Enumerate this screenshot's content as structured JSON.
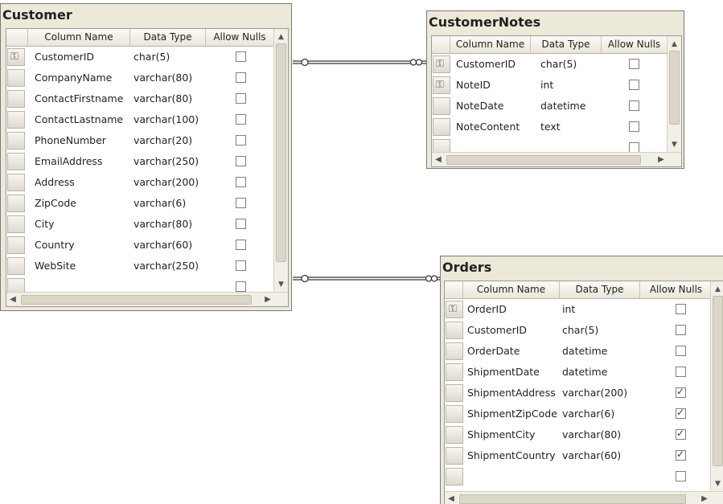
{
  "headers": {
    "column_name": "Column Name",
    "data_type": "Data Type",
    "allow_nulls": "Allow Nulls"
  },
  "tables": {
    "customer": {
      "title": "Customer",
      "rows": [
        {
          "name": "CustomerID",
          "type": "char(5)",
          "pk": true,
          "nulls": false
        },
        {
          "name": "CompanyName",
          "type": "varchar(80)",
          "pk": false,
          "nulls": false
        },
        {
          "name": "ContactFirstname",
          "type": "varchar(80)",
          "pk": false,
          "nulls": false
        },
        {
          "name": "ContactLastname",
          "type": "varchar(100)",
          "pk": false,
          "nulls": false
        },
        {
          "name": "PhoneNumber",
          "type": "varchar(20)",
          "pk": false,
          "nulls": false
        },
        {
          "name": "EmailAddress",
          "type": "varchar(250)",
          "pk": false,
          "nulls": false
        },
        {
          "name": "Address",
          "type": "varchar(200)",
          "pk": false,
          "nulls": false
        },
        {
          "name": "ZipCode",
          "type": "varchar(6)",
          "pk": false,
          "nulls": false
        },
        {
          "name": "City",
          "type": "varchar(80)",
          "pk": false,
          "nulls": false
        },
        {
          "name": "Country",
          "type": "varchar(60)",
          "pk": false,
          "nulls": false
        },
        {
          "name": "WebSite",
          "type": "varchar(250)",
          "pk": false,
          "nulls": false
        }
      ]
    },
    "customer_notes": {
      "title": "CustomerNotes",
      "rows": [
        {
          "name": "CustomerID",
          "type": "char(5)",
          "pk": true,
          "nulls": false
        },
        {
          "name": "NoteID",
          "type": "int",
          "pk": true,
          "nulls": false
        },
        {
          "name": "NoteDate",
          "type": "datetime",
          "pk": false,
          "nulls": false
        },
        {
          "name": "NoteContent",
          "type": "text",
          "pk": false,
          "nulls": false
        }
      ]
    },
    "orders": {
      "title": "Orders",
      "rows": [
        {
          "name": "OrderID",
          "type": "int",
          "pk": true,
          "nulls": false
        },
        {
          "name": "CustomerID",
          "type": "char(5)",
          "pk": false,
          "nulls": false
        },
        {
          "name": "OrderDate",
          "type": "datetime",
          "pk": false,
          "nulls": false
        },
        {
          "name": "ShipmentDate",
          "type": "datetime",
          "pk": false,
          "nulls": false
        },
        {
          "name": "ShipmentAddress",
          "type": "varchar(200)",
          "pk": false,
          "nulls": true
        },
        {
          "name": "ShipmentZipCode",
          "type": "varchar(6)",
          "pk": false,
          "nulls": true
        },
        {
          "name": "ShipmentCity",
          "type": "varchar(80)",
          "pk": false,
          "nulls": true
        },
        {
          "name": "ShipmentCountry",
          "type": "varchar(60)",
          "pk": false,
          "nulls": true
        }
      ]
    }
  },
  "icons": {
    "primary_key": "key-icon",
    "relationship_end": "infinity-icon"
  }
}
